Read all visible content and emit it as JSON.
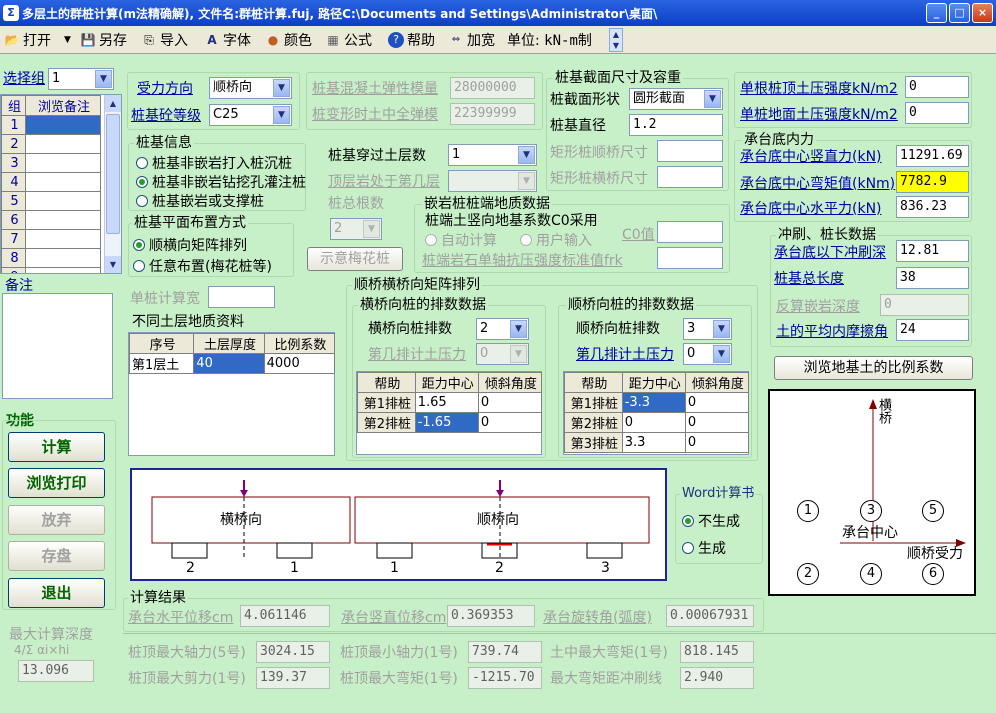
{
  "window": {
    "title": "多层土的群桩计算(m法精确解), 文件名:群桩计算.fuj, 路径C:\\Documents and Settings\\Administrator\\桌面\\",
    "app_icon_glyph": "Σ",
    "minimize": "_",
    "maximize": "□",
    "close": "×"
  },
  "toolbar": {
    "open": "打开",
    "save_as": "另存",
    "import": "导入",
    "font": "字体",
    "color": "颜色",
    "formula": "公式",
    "help": "帮助",
    "widen": "加宽",
    "unit_label": "单位:",
    "unit_value": "kN-m制"
  },
  "group_selector": {
    "label": "选择组",
    "value": "1",
    "col_group": "组",
    "col_note": "浏览备注",
    "rows": [
      "1",
      "2",
      "3",
      "4",
      "5",
      "6",
      "7",
      "8",
      "9"
    ]
  },
  "remarks_label": "备注",
  "force_direction": {
    "label": "受力方向",
    "value": "顺桥向"
  },
  "concrete_grade": {
    "label": "桩基砼等级",
    "value": "C25"
  },
  "elastic": {
    "modulus_label": "桩基混凝土弹性模量",
    "modulus_value": "28000000",
    "deform_label": "桩变形时土中全弹模",
    "deform_value": "22399999"
  },
  "section": {
    "title": "桩基截面尺寸及容重",
    "shape_label": "桩截面形状",
    "shape_value": "圆形截面",
    "diameter_label": "桩基直径",
    "diameter_value": "1.2",
    "rect_long_label": "矩形桩顺桥尺寸",
    "rect_trans_label": "矩形桩横桥尺寸"
  },
  "strength": {
    "top_label": "单根桩顶土压强度kN/m2",
    "top_value": "0",
    "ground_label": "单桩地面土压强度kN/m2",
    "ground_value": "0"
  },
  "pile_info": {
    "title": "桩基信息",
    "options": [
      "桩基非嵌岩打入桩沉桩",
      "桩基非嵌岩钻挖孔灌注桩",
      "桩基嵌岩或支撑桩"
    ],
    "selected": 1
  },
  "layers": {
    "through_label": "桩基穿过土层数",
    "through_value": "1",
    "top_rock_label": "顶层岩处于第几层",
    "total_label": "桩总根数",
    "total_value": "2"
  },
  "rock_end": {
    "title": "嵌岩桩桩端地质数据",
    "c0_label": "桩端土竖向地基系数C0采用",
    "auto": "自动计算",
    "user": "用户输入",
    "c0_value_label": "C0值",
    "frk_label": "桩端岩石单轴抗压强度标准值frk"
  },
  "layout": {
    "title": "桩基平面布置方式",
    "options": [
      "顺横向矩阵排列",
      "任意布置(梅花桩等)"
    ],
    "selected": 0,
    "plum_button": "示意梅花桩"
  },
  "bottom_forces": {
    "title": "承台底内力",
    "vertical_label": "承台底中心竖直力(kN)",
    "vertical_value": "11291.69",
    "moment_label": "承台底中心弯矩值(kNm)",
    "moment_value": "7782.9",
    "horizontal_label": "承台底中心水平力(kN)",
    "horizontal_value": "836.23"
  },
  "scour": {
    "title": "冲刷、桩长数据",
    "depth_label": "承台底以下冲刷深",
    "depth_value": "12.81",
    "length_label": "桩基总长度",
    "length_value": "38",
    "rock_depth_label": "反算嵌岩深度",
    "rock_depth_value": "0",
    "friction_label": "土的平均内摩擦角",
    "friction_value": "24",
    "browse_button": "浏览地基土的比例系数"
  },
  "calc_width": {
    "label": "单桩计算宽"
  },
  "soil_table": {
    "title": "不同土层地质资料",
    "headers": [
      "序号",
      "土层厚度",
      "比例系数"
    ],
    "rows": [
      [
        "第1层土",
        "40",
        "4000"
      ]
    ]
  },
  "matrix": {
    "title": "顺桥横桥向矩阵排列",
    "trans": {
      "title": "横桥向桩的排数数据",
      "count_label": "横桥向桩排数",
      "count_value": "2",
      "nth_label": "第几排计土压力",
      "nth_value": "0",
      "headers": [
        "帮助",
        "距力中心",
        "倾斜角度"
      ],
      "rows": [
        [
          "第1排桩",
          "1.65",
          "0"
        ],
        [
          "第2排桩",
          "-1.65",
          "0"
        ]
      ]
    },
    "long": {
      "title": "顺桥向桩的排数数据",
      "count_label": "顺桥向桩排数",
      "count_value": "3",
      "nth_label": "第几排计土压力",
      "nth_value": "0",
      "headers": [
        "帮助",
        "距力中心",
        "倾斜角度"
      ],
      "rows": [
        [
          "第1排桩",
          "-3.3",
          "0"
        ],
        [
          "第2排桩",
          "0",
          "0"
        ],
        [
          "第3排桩",
          "3.3",
          "0"
        ]
      ]
    }
  },
  "functions": {
    "title": "功能",
    "calculate": "计算",
    "print": "浏览打印",
    "discard": "放弃",
    "save": "存盘",
    "exit": "退出"
  },
  "schematic": {
    "trans_label": "横桥向",
    "long_label": "顺桥向",
    "trans_piles": [
      "2",
      "1"
    ],
    "long_piles": [
      "1",
      "2",
      "3"
    ]
  },
  "word_calc": {
    "title": "Word计算书",
    "no": "不生成",
    "yes": "生成",
    "selected": 0
  },
  "plan": {
    "axis_y": "横桥",
    "axis_x": "顺桥受力",
    "center": "承台中心",
    "piles": [
      "1",
      "3",
      "5",
      "2",
      "4",
      "6"
    ]
  },
  "results": {
    "title": "计算结果",
    "h_disp_label": "承台水平位移cm",
    "h_disp_value": "4.061146",
    "v_disp_label": "承台竖直位移cm",
    "v_disp_value": "0.369353",
    "rot_label": "承台旋转角(弧度)",
    "rot_value": "0.00067931",
    "max_axial_label": "桩顶最大轴力(5号)",
    "max_axial_value": "3024.15",
    "min_axial_label": "桩顶最小轴力(1号)",
    "min_axial_value": "739.74",
    "soil_moment_label": "土中最大弯矩(1号)",
    "soil_moment_value": "818.145",
    "max_shear_label": "桩顶最大剪力(1号)",
    "max_shear_value": "139.37",
    "top_moment_label": "桩顶最大弯矩(1号)",
    "top_moment_value": "-1215.70",
    "moment_dist_label": "最大弯矩距冲刷线",
    "moment_dist_value": "2.940",
    "max_depth_label": "最大计算深度",
    "max_depth_formula": "4/Σ αi×hi",
    "max_depth_value": "13.096"
  },
  "colors": {
    "highlight_input": "#ffff00",
    "selected_cell": "#316ac5",
    "frame_blue": "#2020a0",
    "arrow": "#800080"
  }
}
